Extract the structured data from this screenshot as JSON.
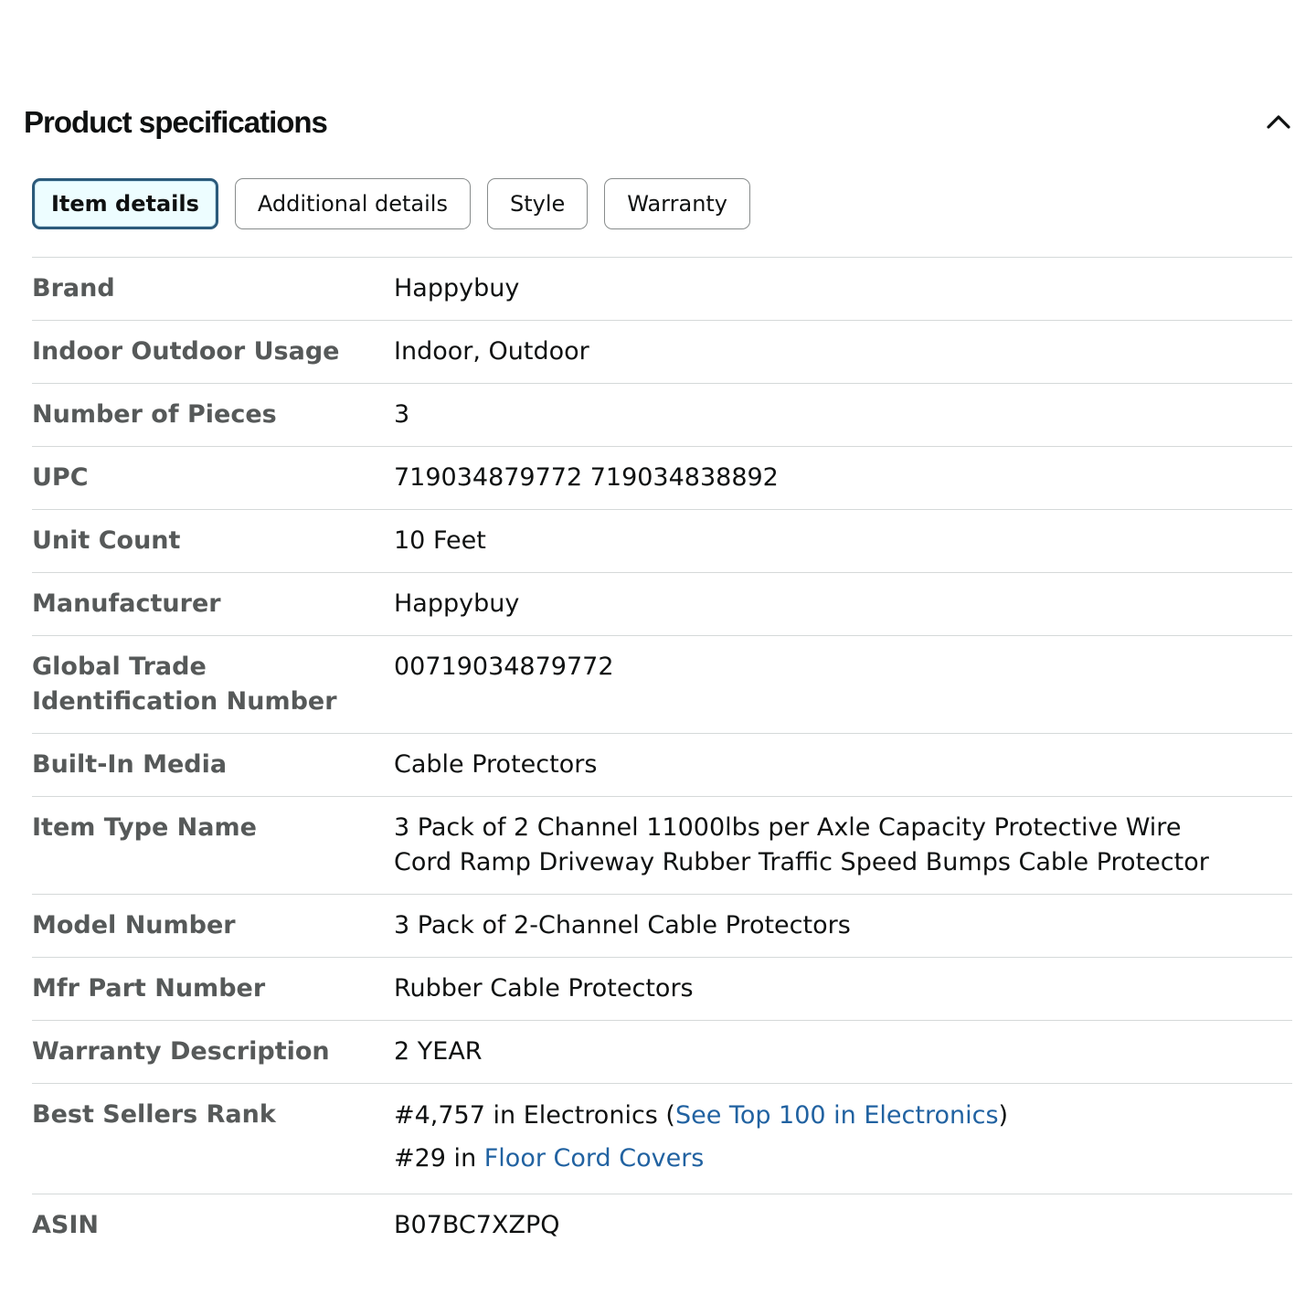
{
  "header": {
    "title": "Product specifications"
  },
  "tabs": [
    {
      "label": "Item details",
      "active": true
    },
    {
      "label": "Additional details",
      "active": false
    },
    {
      "label": "Style",
      "active": false
    },
    {
      "label": "Warranty",
      "active": false
    }
  ],
  "specs": {
    "brand": {
      "label": "Brand",
      "value": "Happybuy"
    },
    "usage": {
      "label": "Indoor Outdoor Usage",
      "value": "Indoor, Outdoor"
    },
    "pieces": {
      "label": "Number of Pieces",
      "value": "3"
    },
    "upc": {
      "label": "UPC",
      "value": "719034879772 719034838892"
    },
    "unit_count": {
      "label": "Unit Count",
      "value": "10 Feet"
    },
    "manufacturer": {
      "label": "Manufacturer",
      "value": "Happybuy"
    },
    "gtin": {
      "label_line1": "Global Trade",
      "label_line2": "Identification Number",
      "value": "00719034879772"
    },
    "media": {
      "label": "Built-In Media",
      "value": "Cable Protectors"
    },
    "item_type": {
      "label": "Item Type Name",
      "value_line1": "3 Pack of 2 Channel 11000lbs per Axle Capacity Protective Wire",
      "value_line2": "Cord Ramp Driveway Rubber Traffic Speed Bumps Cable Protector"
    },
    "model": {
      "label": "Model Number",
      "value": "3 Pack of 2-Channel Cable Protectors"
    },
    "part": {
      "label": "Mfr Part Number",
      "value": "Rubber Cable Protectors"
    },
    "warranty": {
      "label": "Warranty Description",
      "value": "2 YEAR"
    },
    "rank": {
      "label": "Best Sellers Rank",
      "line1_prefix": "#4,757 in Electronics (",
      "line1_link": "See Top 100 in Electronics",
      "line1_suffix": ")",
      "line2_prefix": "#29 in ",
      "line2_link": "Floor Cord Covers"
    },
    "asin": {
      "label": "ASIN",
      "value": "B07BC7XZPQ"
    }
  },
  "colors": {
    "link": "#2162a1",
    "label": "#565959",
    "active_tab_border": "#2b5a7a",
    "active_tab_bg": "#edfdff"
  },
  "icons": {
    "collapse": "chevron-up-icon"
  }
}
